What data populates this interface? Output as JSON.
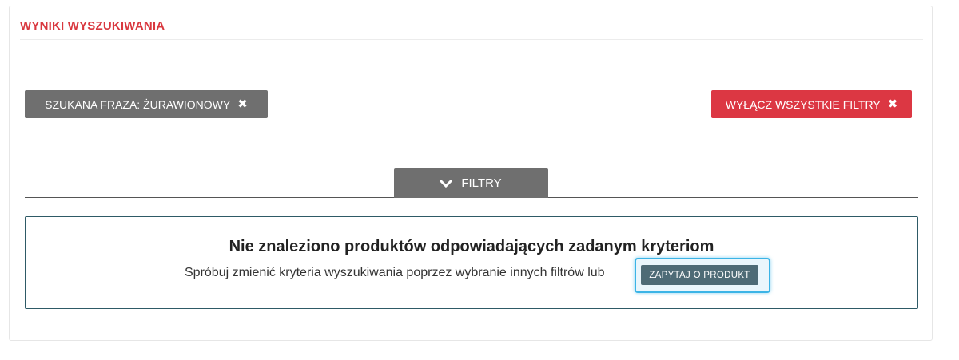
{
  "header": {
    "title": "WYNIKI WYSZUKIWANIA"
  },
  "filters": {
    "search_phrase_label": "SZUKANA FRAZA:",
    "search_phrase_value": "ŻURAWIONOWY",
    "remove_icon": "close-icon",
    "clear_all_label": "WYŁĄCZ WSZYSTKIE FILTRY",
    "toggle_label": "FILTRY",
    "toggle_icon": "chevron-down-icon"
  },
  "results": {
    "empty_title": "Nie znaleziono produktów odpowiadających zadanym kryteriom",
    "empty_subtitle": "Spróbuj zmienić kryteria wyszukiwania poprzez wybranie innych filtrów lub",
    "ask_button_label": "ZAPYTAJ O PRODUKT"
  },
  "colors": {
    "accent_red": "#d9383f",
    "chip_gray": "#6f6f6f",
    "button_teal": "#4e6b76",
    "focus_blue": "#3bb4e6"
  }
}
